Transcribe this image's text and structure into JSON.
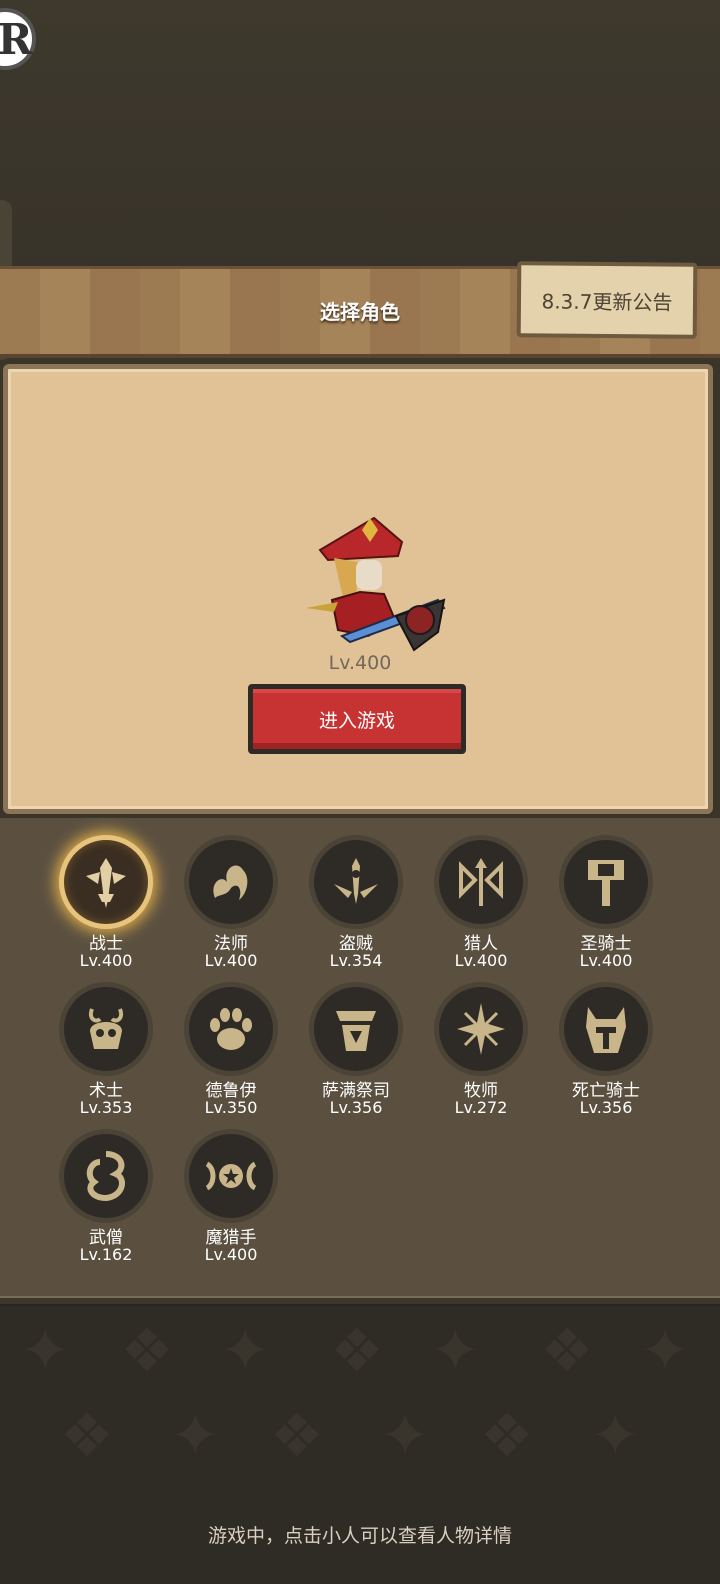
{
  "header": {
    "title": "选择角色",
    "notice_label": "8.3.7更新公告",
    "logo_letter": "R"
  },
  "hero": {
    "level": "Lv.400",
    "enter_label": "进入游戏"
  },
  "classes": [
    {
      "name": "战士",
      "level": "Lv.400",
      "icon": "warrior-icon",
      "selected": true
    },
    {
      "name": "法师",
      "level": "Lv.400",
      "icon": "mage-icon"
    },
    {
      "name": "盗贼",
      "level": "Lv.354",
      "icon": "rogue-icon"
    },
    {
      "name": "猎人",
      "level": "Lv.400",
      "icon": "hunter-icon"
    },
    {
      "name": "圣骑士",
      "level": "Lv.400",
      "icon": "paladin-icon"
    },
    {
      "name": "术士",
      "level": "Lv.353",
      "icon": "warlock-icon"
    },
    {
      "name": "德鲁伊",
      "level": "Lv.350",
      "icon": "druid-icon"
    },
    {
      "name": "萨满祭司",
      "level": "Lv.356",
      "icon": "shaman-icon"
    },
    {
      "name": "牧师",
      "level": "Lv.272",
      "icon": "priest-icon"
    },
    {
      "name": "死亡骑士",
      "level": "Lv.356",
      "icon": "death-knight-icon"
    },
    {
      "name": "武僧",
      "level": "Lv.162",
      "icon": "monk-icon"
    },
    {
      "name": "魔猎手",
      "level": "Lv.400",
      "icon": "demon-hunter-icon"
    }
  ],
  "footer": {
    "hint": "游戏中，点击小人可以查看人物详情"
  },
  "colors": {
    "accent_red": "#c73232",
    "selected_glow": "#e7c47d",
    "icon_gold": "#c9b58a"
  }
}
